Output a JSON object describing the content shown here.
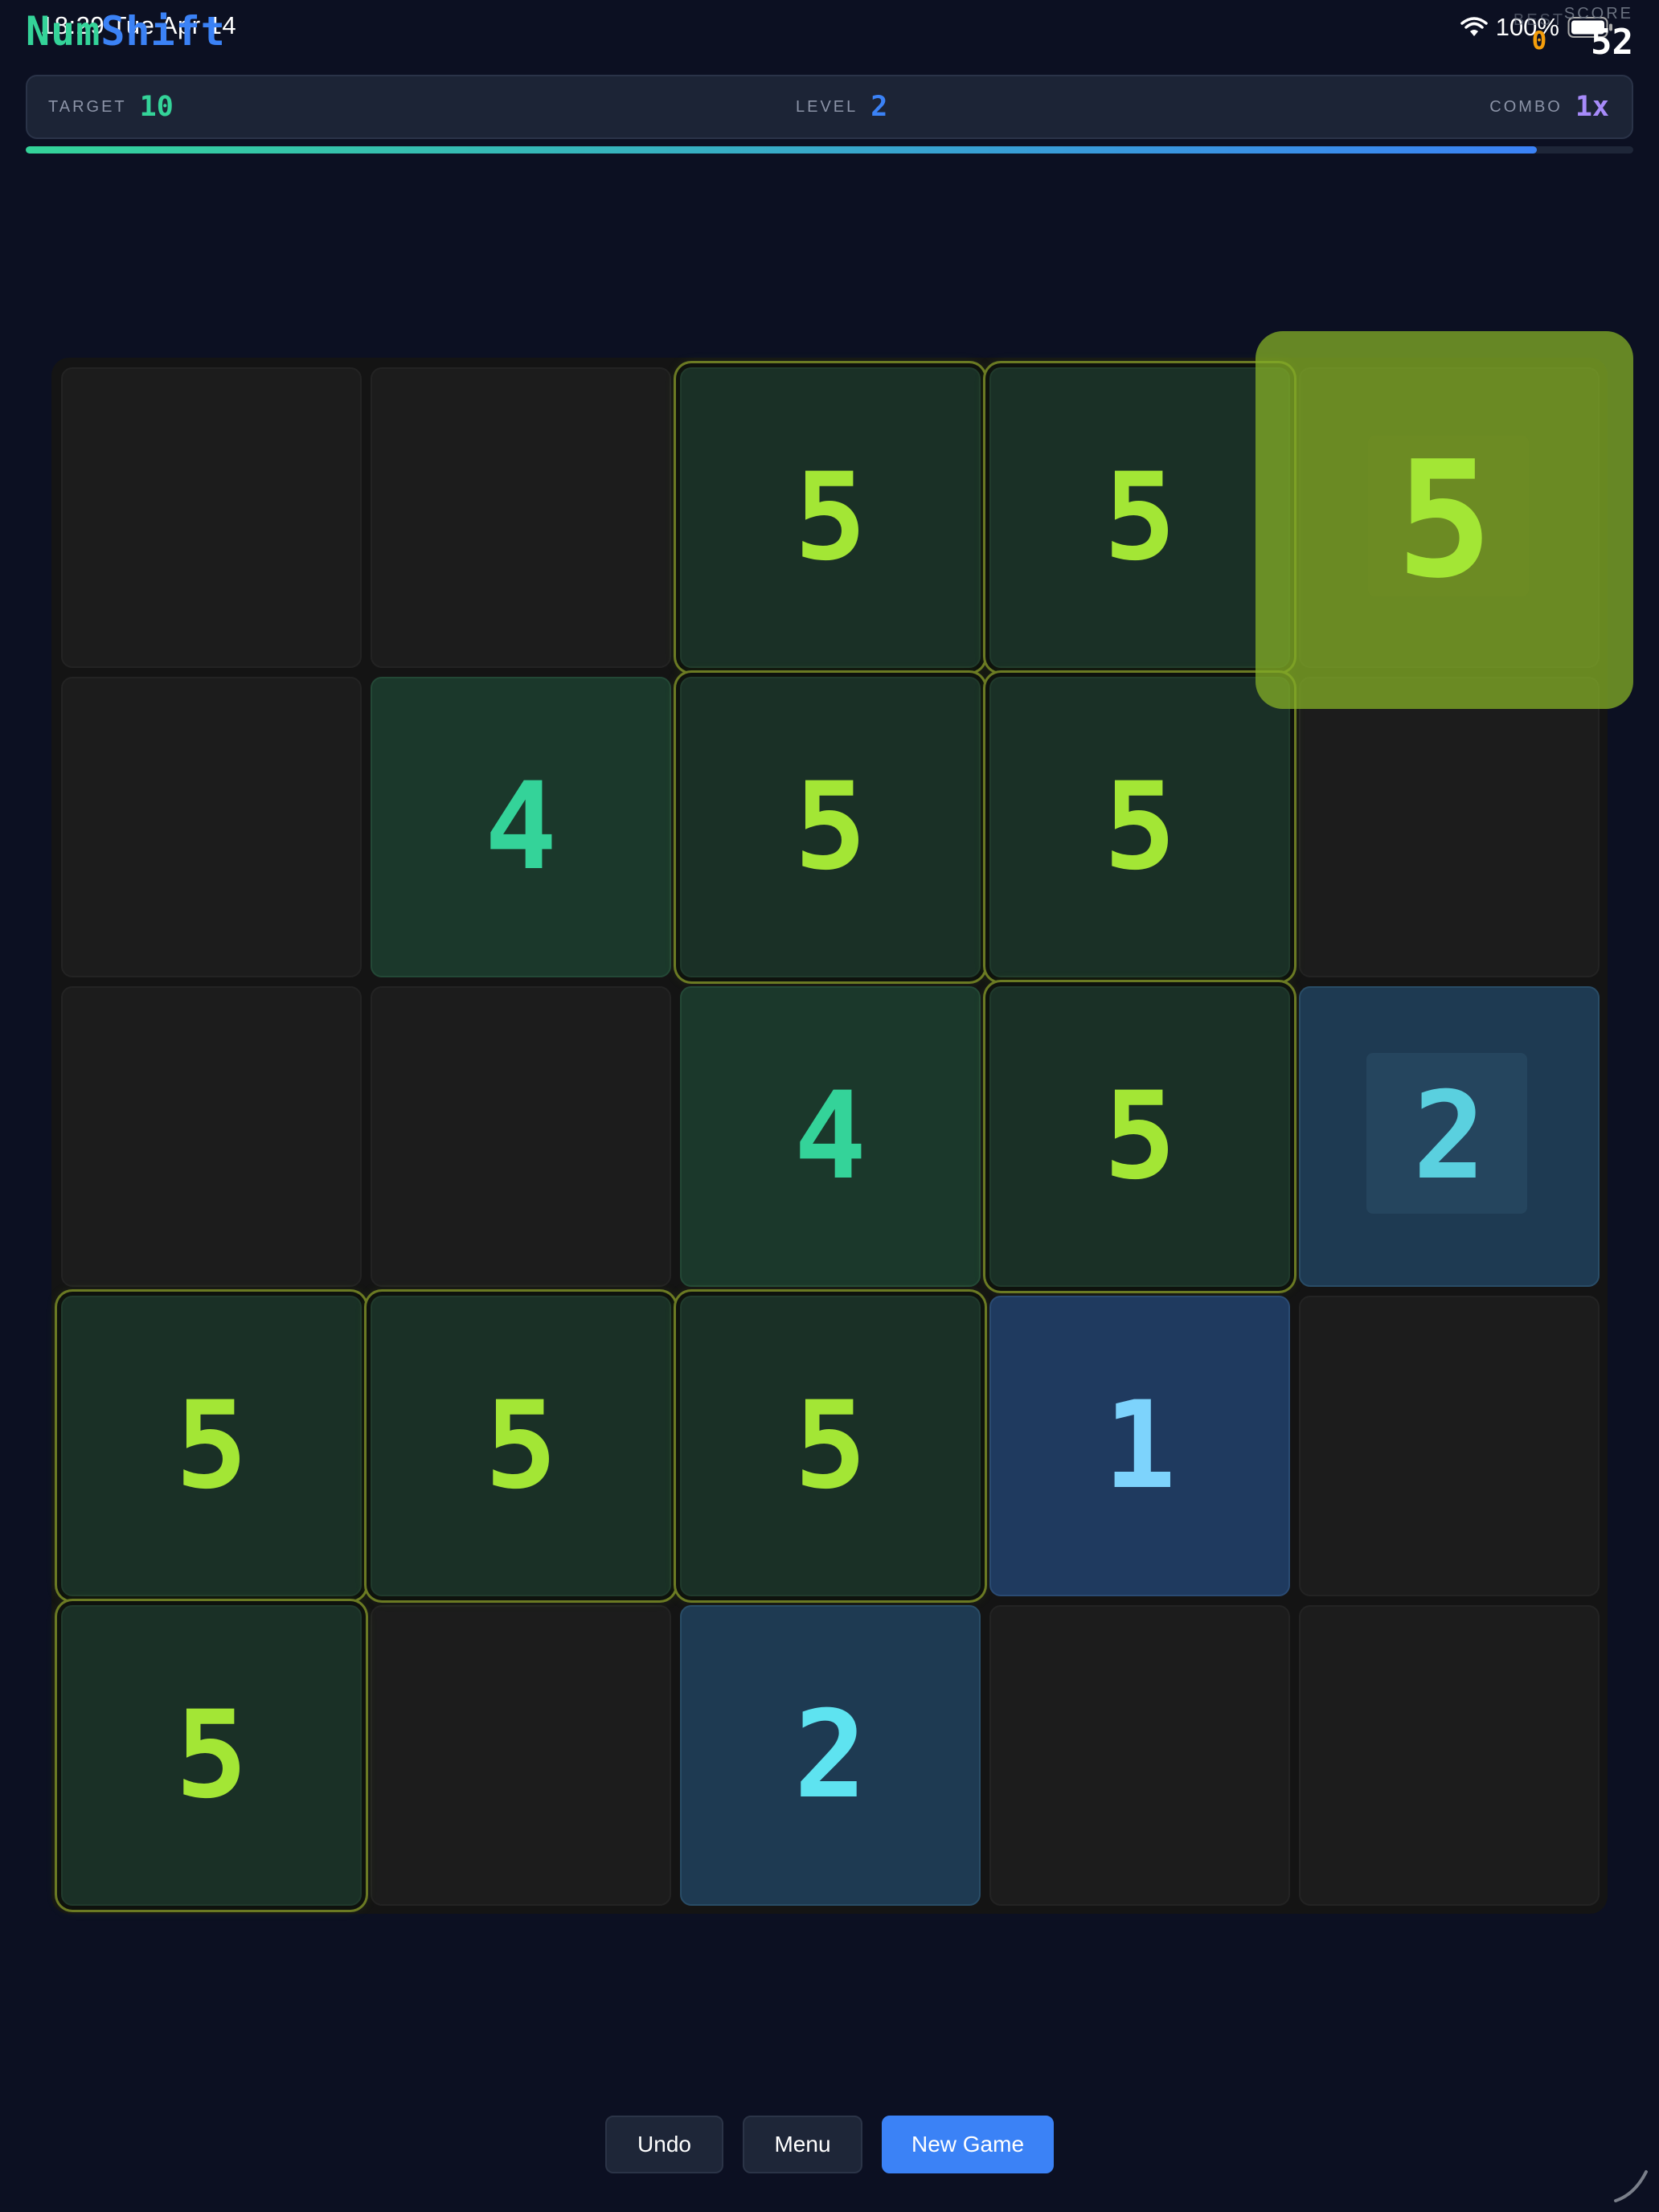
{
  "status_bar": {
    "time_date": "18:29  Tue Apr 14",
    "battery": "100%"
  },
  "header": {
    "title_part_1": "Num",
    "title_part_2": "Shift",
    "best_label": "BEST",
    "best_value": "0",
    "score_label": "SCORE",
    "score_value": "52"
  },
  "info": {
    "target_label": "TARGET",
    "target_value": "10",
    "level_label": "LEVEL",
    "level_value": "2",
    "combo_label": "COMBO",
    "combo_value": "1x"
  },
  "progress": {
    "fraction": 0.94
  },
  "colors": {
    "value_1": "#7dd3fc",
    "value_2": "#5ee3f0",
    "value_4": "#34d399",
    "value_5": "#a3e635",
    "accent": "#3b82f6"
  },
  "board": {
    "rows": 5,
    "cols": 5,
    "tiles": [
      {
        "row": 0,
        "col": 2,
        "value": "5",
        "match": true
      },
      {
        "row": 0,
        "col": 3,
        "value": "5",
        "match": true
      },
      {
        "row": 1,
        "col": 1,
        "value": "4",
        "match": false
      },
      {
        "row": 1,
        "col": 2,
        "value": "5",
        "match": true
      },
      {
        "row": 1,
        "col": 3,
        "value": "5",
        "match": true
      },
      {
        "row": 2,
        "col": 2,
        "value": "4",
        "match": false
      },
      {
        "row": 2,
        "col": 3,
        "value": "5",
        "match": true
      },
      {
        "row": 2,
        "col": 4,
        "value": "2",
        "match": false
      },
      {
        "row": 3,
        "col": 0,
        "value": "5",
        "match": true
      },
      {
        "row": 3,
        "col": 1,
        "value": "5",
        "match": true
      },
      {
        "row": 3,
        "col": 2,
        "value": "5",
        "match": true
      },
      {
        "row": 3,
        "col": 3,
        "value": "1",
        "match": false
      },
      {
        "row": 4,
        "col": 0,
        "value": "5",
        "match": true
      },
      {
        "row": 4,
        "col": 2,
        "value": "2",
        "match": false
      }
    ],
    "dragging_tile": {
      "value": "5"
    }
  },
  "buttons": {
    "undo": "Undo",
    "menu": "Menu",
    "new_game": "New Game"
  }
}
